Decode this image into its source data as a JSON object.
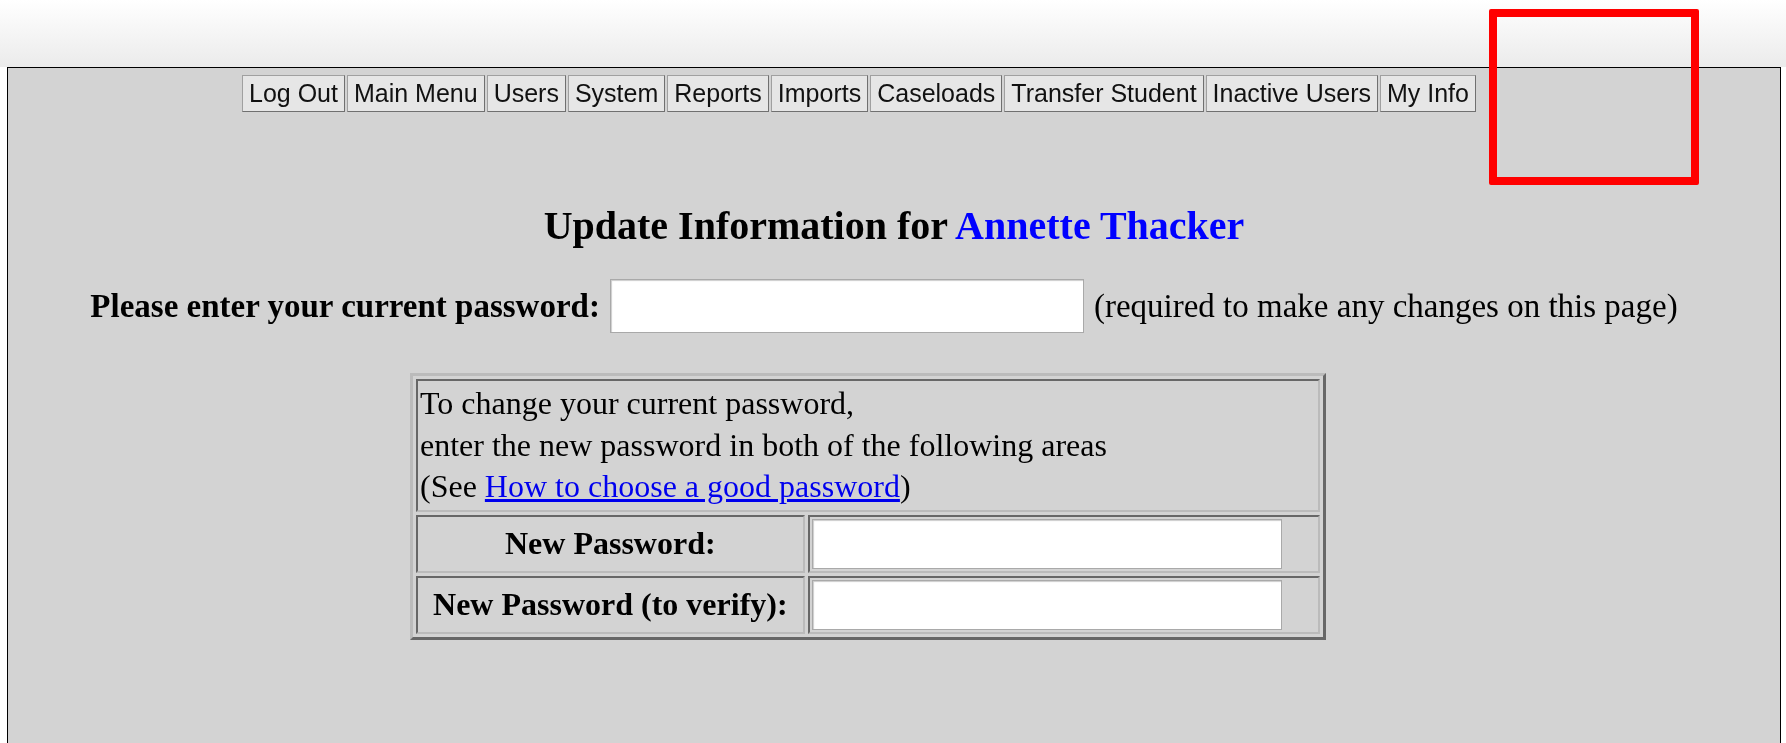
{
  "nav_buttons": [
    {
      "label": "Log Out"
    },
    {
      "label": "Main Menu"
    },
    {
      "label": "Users"
    },
    {
      "label": "System"
    },
    {
      "label": "Reports"
    },
    {
      "label": "Imports"
    },
    {
      "label": "Caseloads"
    },
    {
      "label": "Transfer Student"
    },
    {
      "label": "Inactive Users"
    },
    {
      "label": "My Info"
    }
  ],
  "heading": {
    "text": "Update Information for ",
    "name": "Annette Thacker"
  },
  "current_password": {
    "label": "Please enter your current password:",
    "note": "(required to make any changes on this page)"
  },
  "change_password": {
    "intro_lines": [
      "To change your current password,",
      "enter the new password in both of the following areas"
    ],
    "see_prefix": "(See ",
    "link": "How to choose a good password",
    "see_suffix": ")",
    "fields": [
      {
        "label": "New Password:"
      },
      {
        "label": "New Password (to verify):"
      }
    ]
  }
}
